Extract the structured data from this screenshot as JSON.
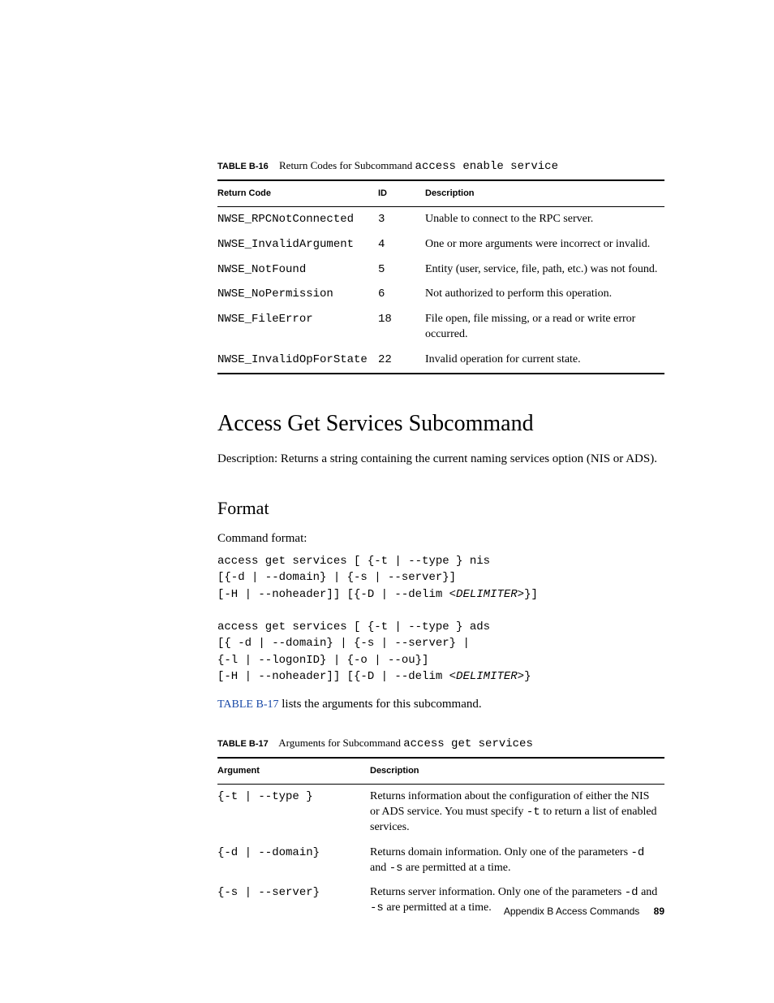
{
  "table16": {
    "label": "TABLE B-16",
    "title": "Return Codes for Subcommand ",
    "title_code": "access enable service",
    "headers": {
      "c1": "Return Code",
      "c2": "ID",
      "c3": "Description"
    },
    "rows": [
      {
        "code": "NWSE_RPCNotConnected",
        "id": "3",
        "desc": "Unable to connect to the RPC server."
      },
      {
        "code": "NWSE_InvalidArgument",
        "id": "4",
        "desc": "One or more arguments were incorrect or invalid."
      },
      {
        "code": "NWSE_NotFound",
        "id": "5",
        "desc": "Entity (user, service, file, path, etc.) was not found."
      },
      {
        "code": "NWSE_NoPermission",
        "id": "6",
        "desc": "Not authorized to perform this operation."
      },
      {
        "code": "NWSE_FileError",
        "id": "18",
        "desc": "File open, file missing, or a read or write error occurred."
      },
      {
        "code": "NWSE_InvalidOpForState",
        "id": "22",
        "desc": "Invalid operation for current state."
      }
    ]
  },
  "section": {
    "heading": "Access Get Services Subcommand",
    "desc": "Description: Returns a string containing the current naming services option (NIS or ADS).",
    "format_heading": "Format",
    "format_intro": "Command format:",
    "code1_l1": "access get services [ {-t | --type } nis",
    "code1_l2": "[{-d | --domain} | {-s | --server}]",
    "code1_l3a": "[-H | --noheader]] [{-D | --delim ",
    "code1_l3i": "<DELIMITER>",
    "code1_l3b": "}]",
    "code2_l1": "access get services [ {-t | --type } ads",
    "code2_l2": "[{ -d | --domain} | {-s | --server} |",
    "code2_l3": "{-l | --logonID} | {-o | --ou}]",
    "code2_l4a": "[-H | --noheader]] [{-D | --delim ",
    "code2_l4i": "<DELIMITER>",
    "code2_l4b": "}",
    "ref_link": "TABLE B-17",
    "ref_text": " lists the arguments for this subcommand."
  },
  "table17": {
    "label": "TABLE B-17",
    "title": "Arguments for Subcommand ",
    "title_code": "access get services",
    "headers": {
      "c1": "Argument",
      "c2": "Description"
    },
    "rows": [
      {
        "arg": "{-t | --type }",
        "d1": "Returns information about the configuration of either the NIS or ADS service. You must specify ",
        "dcode": "-t",
        "d2": " to return a list of enabled services."
      },
      {
        "arg": "{-d | --domain}",
        "d1": "Returns domain information. Only one of the parameters ",
        "dcode": "-d",
        "d2": " and ",
        "dcode2": "-s",
        "d3": " are permitted at a time."
      },
      {
        "arg": "{-s | --server}",
        "d1": "Returns server information. Only one of the parameters ",
        "dcode": "-d",
        "d2": " and ",
        "dcode2": "-s",
        "d3": " are permitted at a time."
      }
    ]
  },
  "footer": {
    "text": "Appendix B      Access Commands",
    "page": "89"
  }
}
